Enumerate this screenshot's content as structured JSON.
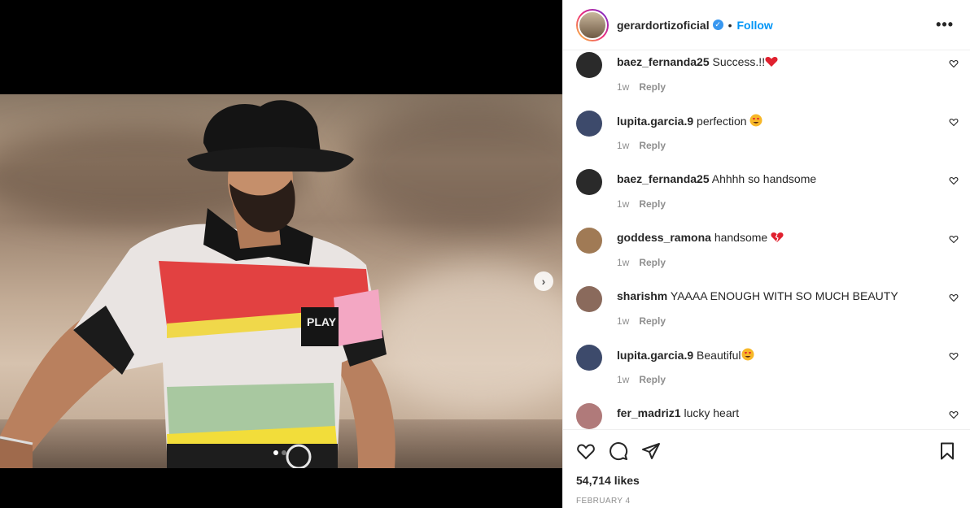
{
  "post": {
    "owner": "gerardortizoficial",
    "separator": "•",
    "follow_label": "Follow",
    "more_icon": "more-icon",
    "media": {
      "slide_count": 2,
      "active_slide": 1
    }
  },
  "comments": [
    {
      "user": "baez_fernanda25",
      "text": "Success.!!",
      "emoji": "heart",
      "age": "1w",
      "reply": "Reply",
      "avatar_color": "#2a2a2a"
    },
    {
      "user": "lupita.garcia.9",
      "text": "perfection",
      "emoji": "heart-eyes",
      "age": "1w",
      "reply": "Reply",
      "avatar_color": "#3d4a6b"
    },
    {
      "user": "baez_fernanda25",
      "text": "Ahhhh so handsome",
      "emoji": "",
      "age": "1w",
      "reply": "Reply",
      "avatar_color": "#2a2a2a"
    },
    {
      "user": "goddess_ramona",
      "text": "handsome",
      "emoji": "broken-heart",
      "age": "1w",
      "reply": "Reply",
      "avatar_color": "#a07a55"
    },
    {
      "user": "sharishm",
      "text": "YAAAA ENOUGH WITH SO MUCH BEAUTY",
      "emoji": "",
      "age": "1w",
      "reply": "Reply",
      "avatar_color": "#8a6a5c"
    },
    {
      "user": "lupita.garcia.9",
      "text": "Beautiful",
      "emoji": "heart-eyes",
      "age": "1w",
      "reply": "Reply",
      "avatar_color": "#3d4a6b"
    },
    {
      "user": "fer_madriz1",
      "text": "lucky heart",
      "emoji": "",
      "age": "1w",
      "reply": "Reply",
      "avatar_color": "#b07a7a"
    }
  ],
  "footer": {
    "likes": "54,714 likes",
    "date": "FEBRUARY 4",
    "icons": [
      "heart-icon",
      "comment-icon",
      "share-icon",
      "bookmark-icon"
    ]
  }
}
